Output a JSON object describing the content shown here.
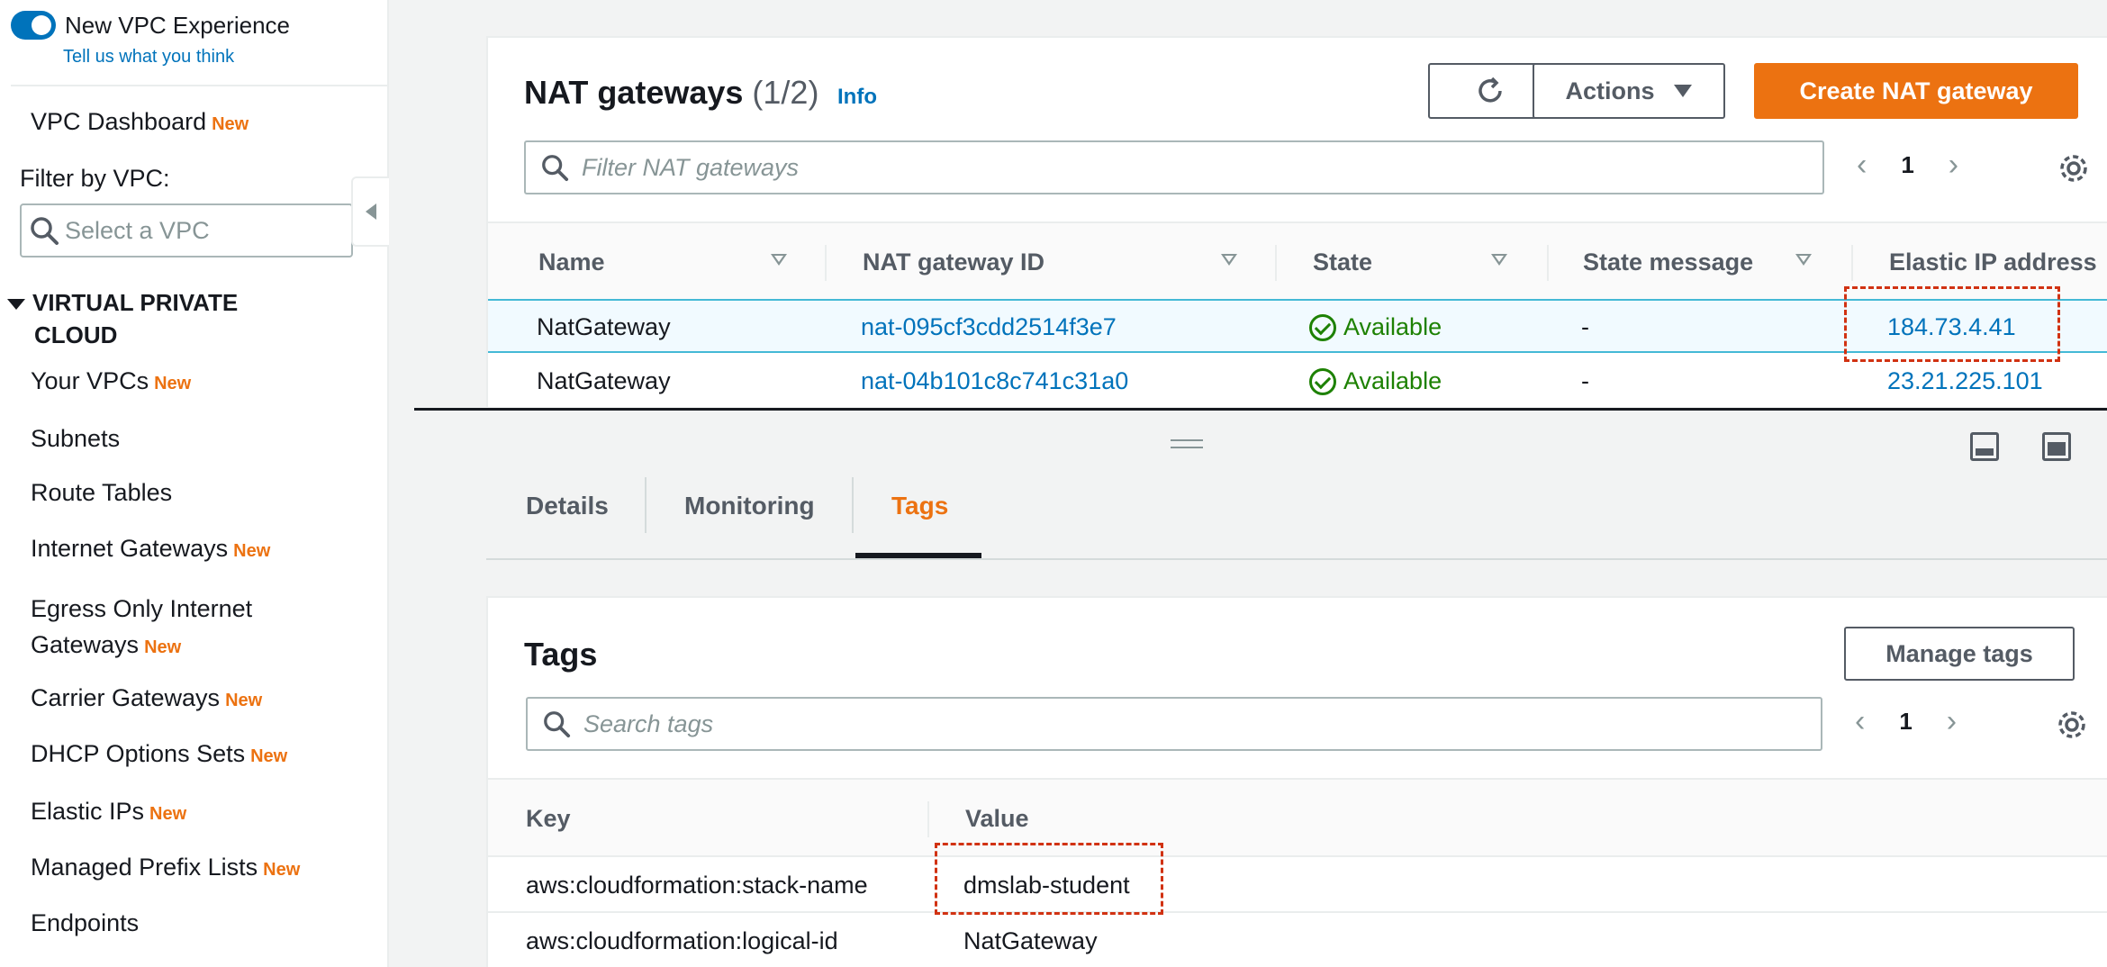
{
  "sidebar": {
    "toggle_label": "New VPC Experience",
    "feedback_link": "Tell us what you think",
    "new_badge": "New",
    "dashboard": "VPC Dashboard",
    "filter_label": "Filter by VPC:",
    "vpc_select_placeholder": "Select a VPC",
    "section_line1": "VIRTUAL PRIVATE",
    "section_line2": "CLOUD",
    "items": [
      {
        "label": "Your VPCs",
        "new": true
      },
      {
        "label": "Subnets",
        "new": false
      },
      {
        "label": "Route Tables",
        "new": false
      },
      {
        "label": "Internet Gateways",
        "new": true
      },
      {
        "label_line1": "Egress Only Internet",
        "label_line2": "Gateways",
        "new": true
      },
      {
        "label": "Carrier Gateways",
        "new": true
      },
      {
        "label": "DHCP Options Sets",
        "new": true
      },
      {
        "label": "Elastic IPs",
        "new": true
      },
      {
        "label": "Managed Prefix Lists",
        "new": true
      },
      {
        "label": "Endpoints",
        "new": false
      }
    ]
  },
  "nat": {
    "title": "NAT gateways",
    "count": "(1/2)",
    "info": "Info",
    "actions_label": "Actions",
    "create_label": "Create NAT gateway",
    "filter_placeholder": "Filter NAT gateways",
    "page": "1",
    "columns": [
      "Name",
      "NAT gateway ID",
      "State",
      "State message",
      "Elastic IP address"
    ],
    "rows": [
      {
        "name": "NatGateway",
        "id": "nat-095cf3cdd2514f3e7",
        "state": "Available",
        "message": "-",
        "eip": "184.73.4.41"
      },
      {
        "name": "NatGateway",
        "id": "nat-04b101c8c741c31a0",
        "state": "Available",
        "message": "-",
        "eip": "23.21.225.101"
      }
    ]
  },
  "tabs": [
    "Details",
    "Monitoring",
    "Tags"
  ],
  "active_tab": "Tags",
  "tags": {
    "title": "Tags",
    "manage_label": "Manage tags",
    "search_placeholder": "Search tags",
    "page": "1",
    "columns": [
      "Key",
      "Value"
    ],
    "rows": [
      {
        "key": "aws:cloudformation:stack-name",
        "value": "dmslab-student"
      },
      {
        "key": "aws:cloudformation:logical-id",
        "value": "NatGateway"
      }
    ]
  },
  "colors": {
    "accent": "#ec7211",
    "link": "#0073bb",
    "success": "#1d8102",
    "highlight": "#d13212"
  }
}
